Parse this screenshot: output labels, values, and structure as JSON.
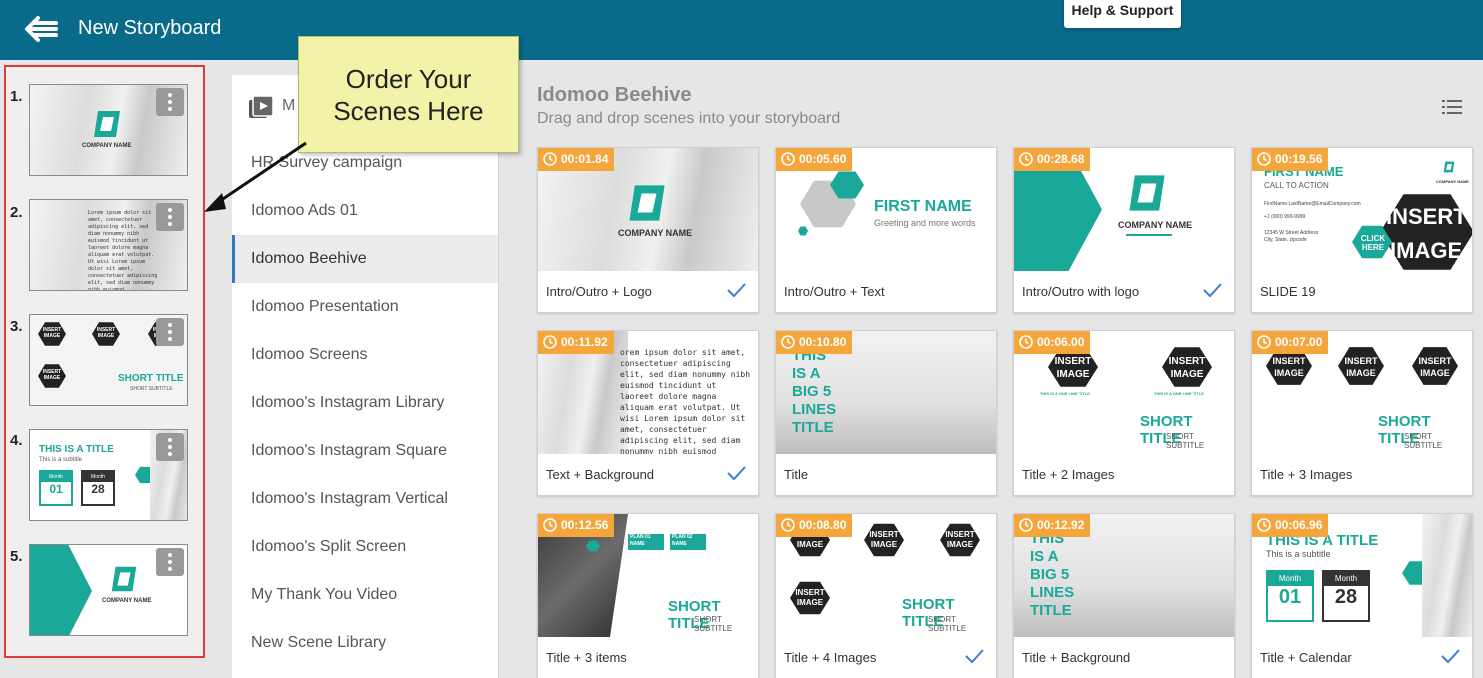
{
  "header": {
    "title": "New Storyboard",
    "help_label": "Help & Support"
  },
  "callout": {
    "line1": "Order Your",
    "line2": "Scenes Here"
  },
  "storyboard": {
    "slots": [
      {
        "number": "1.",
        "art_text": "COMPANY NAME"
      },
      {
        "number": "2.",
        "art_text": "Lorem ipsum dolor sit amet, consectetuer adipiscing elit, sed diam nonummy nibh euismod tincidunt ut laoreet dolore magna aliquam erat volutpat. Ut wisi Lorem ipsum dolor sit amet, consectetuer adipiscing elit, sed diam nonummy nibh euismod"
      },
      {
        "number": "3.",
        "art_text": "INSERT IMAGE",
        "title": "SHORT TITLE",
        "subtitle": "SHORT SUBTITLE"
      },
      {
        "number": "4.",
        "title": "THIS IS A TITLE",
        "subtitle": "This is a subtitle",
        "month": "Month",
        "day1": "01",
        "day2": "28"
      },
      {
        "number": "5.",
        "art_text": "COMPANY NAME"
      }
    ]
  },
  "library_panel": {
    "header_text": "M",
    "items": [
      {
        "label": "HR Survey campaign",
        "active": false
      },
      {
        "label": "Idomoo Ads 01",
        "active": false
      },
      {
        "label": "Idomoo Beehive",
        "active": true
      },
      {
        "label": "Idomoo Presentation",
        "active": false
      },
      {
        "label": "Idomoo Screens",
        "active": false
      },
      {
        "label": "Idomoo's Instagram Library",
        "active": false
      },
      {
        "label": "Idomoo's Instagram Square",
        "active": false
      },
      {
        "label": "Idomoo's Instagram Vertical",
        "active": false
      },
      {
        "label": "Idomoo's Split Screen",
        "active": false
      },
      {
        "label": "My Thank You Video",
        "active": false
      },
      {
        "label": "New Scene Library",
        "active": false
      }
    ]
  },
  "gallery": {
    "title": "Idomoo Beehive",
    "subtitle": "Drag and drop scenes into your storyboard",
    "accent_color": "#f4a63c",
    "brand_teal": "#1aa898",
    "scenes": [
      {
        "duration": "00:01.84",
        "label": "Intro/Outro + Logo",
        "checked": true,
        "art_text": "COMPANY NAME"
      },
      {
        "duration": "00:05.60",
        "label": "Intro/Outro + Text",
        "checked": false,
        "art_title": "FIRST NAME",
        "art_sub": "Greeting and more words"
      },
      {
        "duration": "00:28.68",
        "label": "Intro/Outro with logo",
        "checked": true,
        "art_text": "COMPANY NAME"
      },
      {
        "duration": "00:19.56",
        "label": "SLIDE 19",
        "checked": false,
        "art_title": "FIRST NAME",
        "art_sub": "CALL TO ACTION",
        "art_lines": [
          "FirstName.LastName@EmailCompany.com",
          "+1 (000) 999-9999",
          "12345 W Street Address",
          "City, State, zipcode"
        ],
        "art_click": "CLICK HERE",
        "art_insert1": "INSERT",
        "art_insert2": "IMAGE",
        "art_company": "COMPANY NAME"
      },
      {
        "duration": "00:11.92",
        "label": "Text + Background",
        "checked": true,
        "art_text": "orem ipsum dolor sit amet, consectetuer adipiscing elit, sed diam nonummy nibh euismod tincidunt ut laoreet dolore magna aliquam erat volutpat. Ut wisi Lorem ipsum dolor sit amet, consectetuer adipiscing elit, sed diam nonummy nibh euismod"
      },
      {
        "duration": "00:10.80",
        "label": "Title",
        "checked": false,
        "art_lines": [
          "THIS",
          "IS A",
          "BIG 5",
          "LINES",
          "TITLE"
        ]
      },
      {
        "duration": "00:06.00",
        "label": "Title + 2 Images",
        "checked": false,
        "art_insert": "INSERT IMAGE",
        "art_small": "THIS IS A ONE LINE TITLE",
        "art_small2": "This is a one line subtitle",
        "art_title": "SHORT TITLE",
        "art_sub": "SHORT SUBTITLE"
      },
      {
        "duration": "00:07.00",
        "label": "Title + 3 Images",
        "checked": false,
        "art_insert": "INSERT IMAGE",
        "art_small": "THIS IS A ONE LINE TITLE",
        "art_small2": "This is a one line subtitle",
        "art_title": "SHORT TITLE",
        "art_sub": "SHORT SUBTITLE"
      },
      {
        "duration": "00:12.56",
        "label": "Title + 3 items",
        "checked": false,
        "art_plan1": "PLAN 01 NAME",
        "art_plan2": "PLAN 02 NAME",
        "art_title": "SHORT TITLE",
        "art_sub": "SHORT SUBTITLE"
      },
      {
        "duration": "00:08.80",
        "label": "Title + 4 Images",
        "checked": true,
        "art_insert": "INSERT IMAGE",
        "art_small": "THIS IS A ONE LINE TITLE",
        "art_small2": "This is a one line subtitle",
        "art_title": "SHORT TITLE",
        "art_sub": "SHORT SUBTITLE"
      },
      {
        "duration": "00:12.92",
        "label": "Title + Background",
        "checked": false,
        "art_lines": [
          "THIS",
          "IS A",
          "BIG 5",
          "LINES",
          "TITLE"
        ]
      },
      {
        "duration": "00:06.96",
        "label": "Title + Calendar",
        "checked": true,
        "art_title": "THIS IS A TITLE",
        "art_sub": "This is a subtitle",
        "month": "Month",
        "day1": "01",
        "day2": "28"
      }
    ]
  }
}
